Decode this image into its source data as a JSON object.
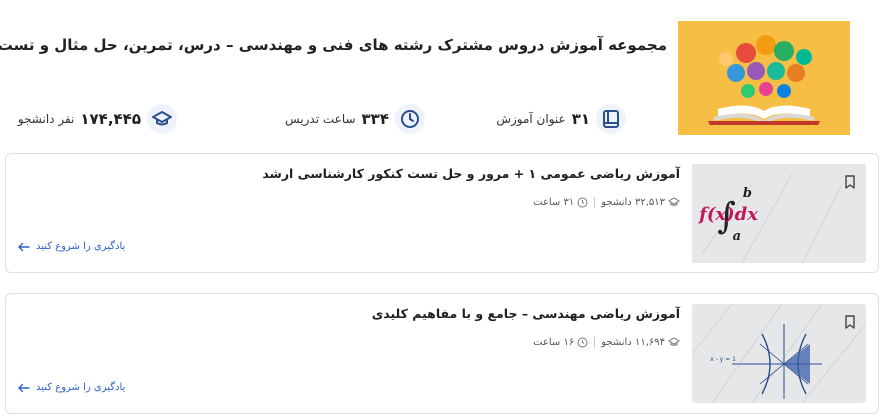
{
  "header": {
    "title": "مجموعه آموزش دروس مشترک رشته های فنی و مهندسی – درس، تمرین، حل مثال و تست",
    "stats": [
      {
        "icon": "book-icon",
        "value": "۳۱",
        "label": "عنوان آموزش"
      },
      {
        "icon": "clock-icon",
        "value": "۳۳۴",
        "label": "ساعت تدریس"
      },
      {
        "icon": "graduation-cap-icon",
        "value": "۱۷۴,۴۴۵",
        "label": "نفر دانشجو"
      }
    ]
  },
  "courses": [
    {
      "title": "آموزش ریاضی عمومی ۱ + مرور و حل تست کنکور کارشناسی ارشد",
      "students": "۳۲,۵۱۳ دانشجو",
      "hours": "۳۱ ساعت",
      "cta": "یادگیری را شروع کنید",
      "thumb_icon": "integral-formula-image"
    },
    {
      "title": "آموزش ریاضی مهندسی – جامع و با مفاهیم کلیدی",
      "students": "۱۱,۶۹۴ دانشجو",
      "hours": "۱۶ ساعت",
      "cta": "یادگیری را شروع کنید",
      "thumb_icon": "graph-curves-image"
    }
  ],
  "colors": {
    "accent": "#2f63c9",
    "icon_blue": "#2c4f8f",
    "hero_bg": "#f6be45",
    "integral_red": "#c2185b"
  }
}
